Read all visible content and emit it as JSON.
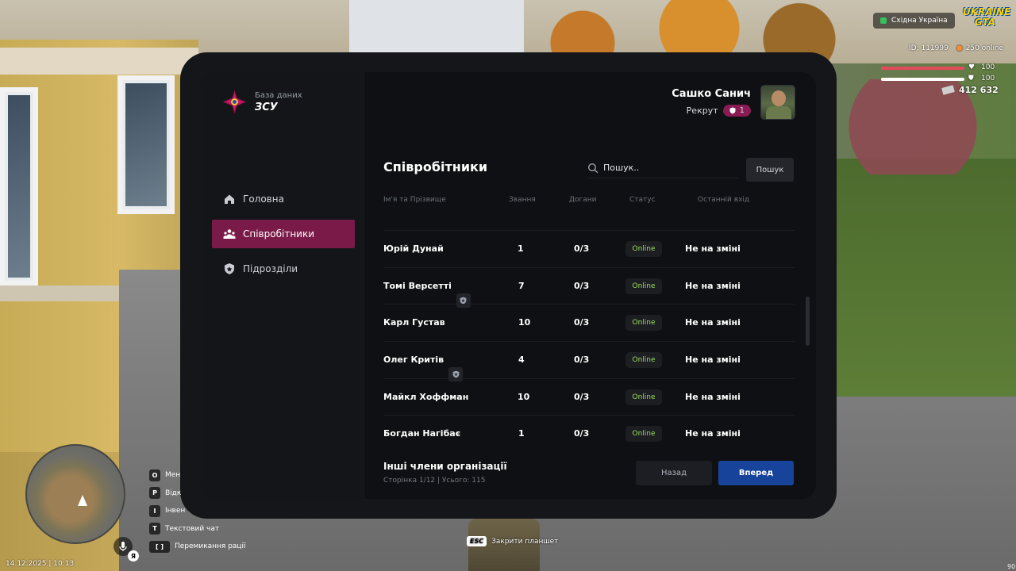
{
  "app": {
    "brand_subtitle": "База даних",
    "brand_title": "ЗСУ",
    "accent_color": "#7a1a48",
    "primary_button_color": "#17439a",
    "status_color": "#9be15d"
  },
  "user": {
    "name": "Сашко Санич",
    "rank_label": "Рекрут",
    "rank_level": "1"
  },
  "sidebar": {
    "items": [
      {
        "label": "Головна",
        "icon": "home-icon",
        "active": false
      },
      {
        "label": "Співробітники",
        "icon": "users-icon",
        "active": true
      },
      {
        "label": "Підрозділи",
        "icon": "shield-icon",
        "active": false
      }
    ]
  },
  "main": {
    "title": "Співробітники",
    "search_placeholder": "Пошук..",
    "search_button": "Пошук",
    "columns": [
      "Ім'я та Прізвище",
      "Звання",
      "Догани",
      "Статус",
      "Останній вхід"
    ],
    "rows": [
      {
        "name": "Юрій Дунай",
        "tag": false,
        "rank": "1",
        "reprimands": "0/3",
        "status": "Online",
        "last_login": "Не на зміні"
      },
      {
        "name": "Томі Версетті",
        "tag": true,
        "rank": "7",
        "reprimands": "0/3",
        "status": "Online",
        "last_login": "Не на зміні"
      },
      {
        "name": "Карл Густав",
        "tag": false,
        "rank": "10",
        "reprimands": "0/3",
        "status": "Online",
        "last_login": "Не на зміні"
      },
      {
        "name": "Олег Критів",
        "tag": true,
        "rank": "4",
        "reprimands": "0/3",
        "status": "Online",
        "last_login": "Не на зміні"
      },
      {
        "name": "Майкл Хоффман",
        "tag": false,
        "rank": "10",
        "reprimands": "0/3",
        "status": "Online",
        "last_login": "Не на зміні"
      },
      {
        "name": "Богдан Нагібає",
        "tag": false,
        "rank": "1",
        "reprimands": "0/3",
        "status": "Online",
        "last_login": "Не на зміні"
      }
    ],
    "footer_title": "Інші члени організації",
    "footer_meta": "Сторінка 1/12 | Усього: 115",
    "back_button": "Назад",
    "next_button": "Вперед"
  },
  "hud": {
    "server": "Східна Україна",
    "logo": "UKRAINE GTA",
    "player_id": "ID: 111999",
    "online": "250 online",
    "health": "100",
    "armor": "100",
    "health_fraction": 1.0,
    "armor_fraction": 1.0,
    "money": "412 632",
    "keys": [
      {
        "key": "O",
        "label": "Мен"
      },
      {
        "key": "P",
        "label": "Відк"
      },
      {
        "key": "I",
        "label": "Інвен"
      },
      {
        "key": "T",
        "label": "Текстовий чат"
      },
      {
        "key": "[   ]",
        "label": "Перемикання рації"
      }
    ],
    "mic_language": "Я",
    "datetime": "14.12.2025 | 10:13",
    "esc_key": "ESC",
    "esc_label": "Закрити планшет",
    "corner_value": "90"
  }
}
